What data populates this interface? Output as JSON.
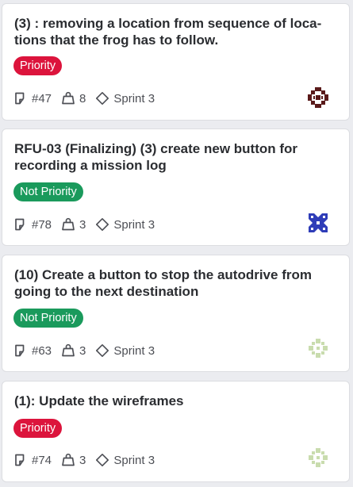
{
  "cards": [
    {
      "title": "(3) : removing a location from sequence of loca-tions that the frog has to follow.",
      "priority": "Priority",
      "issue": "#47",
      "points": "8",
      "sprint": "Sprint 3",
      "avatar_color": "#5a1a1a"
    },
    {
      "title": "RFU-03 (Finalizing) (3) create new button for recording a mission log",
      "priority": "Not Priority",
      "issue": "#78",
      "points": "3",
      "sprint": "Sprint 3",
      "avatar_color": "#2f3db8"
    },
    {
      "title": "(10) Create a button to stop the autodrive from going to the next destination",
      "priority": "Not Priority",
      "issue": "#63",
      "points": "3",
      "sprint": "Sprint 3",
      "avatar_color": "#c9dcae"
    },
    {
      "title": "(1): Update the wireframes",
      "priority": "Priority",
      "issue": "#74",
      "points": "3",
      "sprint": "Sprint 3",
      "avatar_color": "#c9dcae"
    }
  ],
  "colors": {
    "priority": "#dc143c",
    "not_priority": "#1a9a5c"
  }
}
